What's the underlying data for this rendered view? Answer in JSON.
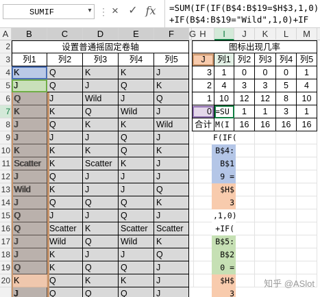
{
  "name_box": {
    "value": "SUMIF"
  },
  "formula_bar": {
    "cancel_icon": "×",
    "enter_icon": "✓",
    "fx_label": "fx",
    "formula_lines": [
      "=SUM(IF(IF(B$4:B$19=$H$3,1,0)",
      "+IF(B$4:B$19=\"Wild\",1,0)+IF"
    ]
  },
  "columns": [
    "A",
    "B",
    "C",
    "D",
    "E",
    "F",
    "G",
    "H",
    "I",
    "J",
    "K",
    "L",
    "M"
  ],
  "row_numbers": [
    "2",
    "3",
    "4",
    "5",
    "6",
    "7",
    "8",
    "9",
    "10",
    "11",
    "12",
    "13",
    "14",
    "15",
    "16",
    "17",
    "18",
    "19",
    "20"
  ],
  "reel_table": {
    "title": "设置普通摇固定卷轴",
    "headers": [
      "列1",
      "列2",
      "列3",
      "列4",
      "列5"
    ],
    "rows": [
      [
        "K",
        "Q",
        "K",
        "K",
        "J"
      ],
      [
        "J",
        "Q",
        "J",
        "Q",
        "K"
      ],
      [
        "Q",
        "J",
        "Wild",
        "J",
        "Q"
      ],
      [
        "K",
        "K",
        "Q",
        "Wild",
        "J"
      ],
      [
        "J",
        "Q",
        "K",
        "K",
        "Wild"
      ],
      [
        "J",
        "J",
        "J",
        "Q",
        "J"
      ],
      [
        "K",
        "K",
        "K",
        "Q",
        "K"
      ],
      [
        "Scatter",
        "K",
        "Scatter",
        "K",
        "J"
      ],
      [
        "J",
        "Q",
        "J",
        "J",
        "J"
      ],
      [
        "Wild",
        "K",
        "J",
        "J",
        "Q"
      ],
      [
        "J",
        "Q",
        "Q",
        "Q",
        "K"
      ],
      [
        "Q",
        "J",
        "J",
        "Q",
        "J"
      ],
      [
        "Q",
        "Scatter",
        "K",
        "Scatter",
        "Scatter"
      ],
      [
        "J",
        "Wild",
        "Q",
        "Wild",
        "K"
      ],
      [
        "J",
        "K",
        "J",
        "J",
        "Q"
      ],
      [
        "Q",
        "K",
        "Q",
        "Q",
        "J"
      ],
      [
        "K",
        "Q",
        "K",
        "K",
        "J"
      ],
      [
        "J",
        "Q",
        "Q",
        "Q",
        "J"
      ]
    ]
  },
  "icon_table": {
    "title": "图标出现几率",
    "corner_header": "J",
    "headers": [
      "列1",
      "列2",
      "列3",
      "列4",
      "列5"
    ],
    "rows": [
      {
        "label": "3",
        "values": [
          "1",
          "0",
          "0",
          "0",
          "1"
        ]
      },
      {
        "label": "2",
        "values": [
          "4",
          "3",
          "3",
          "5",
          "4"
        ]
      },
      {
        "label": "1",
        "values": [
          "10",
          "12",
          "12",
          "8",
          "10"
        ]
      },
      {
        "label": "0",
        "values": [
          "=SU",
          "1",
          "1",
          "3",
          "1"
        ]
      },
      {
        "label": "合计",
        "values": [
          "M(I",
          "16",
          "16",
          "16",
          "16"
        ]
      }
    ]
  },
  "formula_overflow": [
    "F(IF(",
    "B$4:",
    "B$1",
    "9 =",
    "$H$",
    "3",
    ",1,0)",
    "+IF(",
    "B$5:",
    "B$2",
    "0 =",
    "$H$",
    "3"
  ],
  "colors": {
    "reel_fill": "#d9d9d9",
    "header_accent": "#107c41",
    "ref_blue_fill": "#b4c6e7",
    "ref_blue_border": "#4a6fb5",
    "ref_green_fill": "#c6e0b4",
    "ref_green_border": "#70ad47",
    "ref_pink_fill": "#f8cbad",
    "ref_tan_border": "#c9956b",
    "ref_brown_fill": "#a08f86",
    "ref_purple_fill": "#e4d7ea",
    "ref_purple_border": "#8e6fae"
  },
  "watermark": "知乎 @ASlot"
}
